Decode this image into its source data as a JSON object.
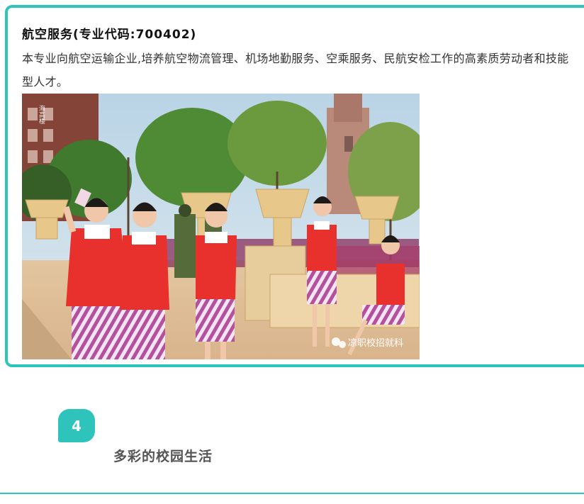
{
  "major": {
    "title": "航空服务(专业代码:700402)",
    "description": "本专业向航空运输企业,培养航空物流管理、机场地勤服务、空乘服务、民航安检工作的高素质劳动者和技能型人才。"
  },
  "photo": {
    "building_sign": "海高楼",
    "watermark": "凉职校招就科",
    "watermark_icon": "wechat-icon"
  },
  "section": {
    "number": "4",
    "title": "多彩的校园生活"
  },
  "colors": {
    "accent": "#2ec4bc",
    "uniform_red": "#e8312c",
    "skirt_purple": "#b4509e"
  }
}
